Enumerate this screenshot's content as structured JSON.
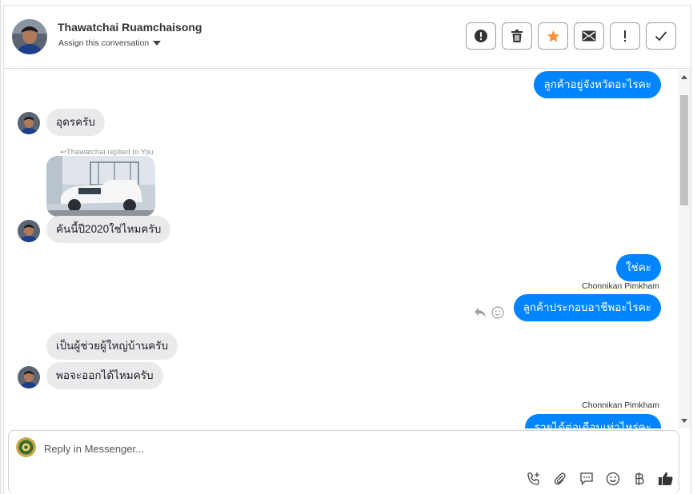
{
  "header": {
    "contact_name": "Thawatchai Ruamchaisong",
    "assign_label": "Assign this conversation",
    "actions": [
      {
        "name": "mark-spam-button",
        "icon": "alert-circle-icon"
      },
      {
        "name": "delete-button",
        "icon": "trash-icon"
      },
      {
        "name": "star-button",
        "icon": "star-icon",
        "color": "#f7923a"
      },
      {
        "name": "mark-unread-button",
        "icon": "envelope-icon"
      },
      {
        "name": "follow-up-button",
        "icon": "exclamation-icon"
      },
      {
        "name": "mark-done-button",
        "icon": "checkmark-icon"
      }
    ]
  },
  "messages": {
    "m1": "ลูกค้าอยู่จังหวัดอะไรคะ",
    "m2": "อุดรครับ",
    "replied_label": "Thawatchai replied to You",
    "m3": "คันนี้ปี2020ใช่ไหมครับ",
    "m4": "ใช่คะ",
    "sender1": "Chonnikan Pimkham",
    "m5": "ลูกค้าประกอบอาชีพอะไรคะ",
    "m6": "เป็นผู้ช่วยผู้ใหญ่บ้านครับ",
    "m7": "พอจะออกได้ไหมครับ",
    "sender2": "Chonnikan Pimkham",
    "m8": "รายได้ต่อเดือนเท่าไหร่คะ"
  },
  "composer": {
    "placeholder": "Reply in Messenger..."
  },
  "tools": [
    "phone-add-icon",
    "paperclip-icon",
    "saved-reply-icon",
    "emoji-icon",
    "baht-icon",
    "thumbs-up-icon"
  ],
  "colors": {
    "outgoing_bubble": "#0084ff",
    "incoming_bubble": "#e9eaec",
    "star": "#f7923a"
  }
}
